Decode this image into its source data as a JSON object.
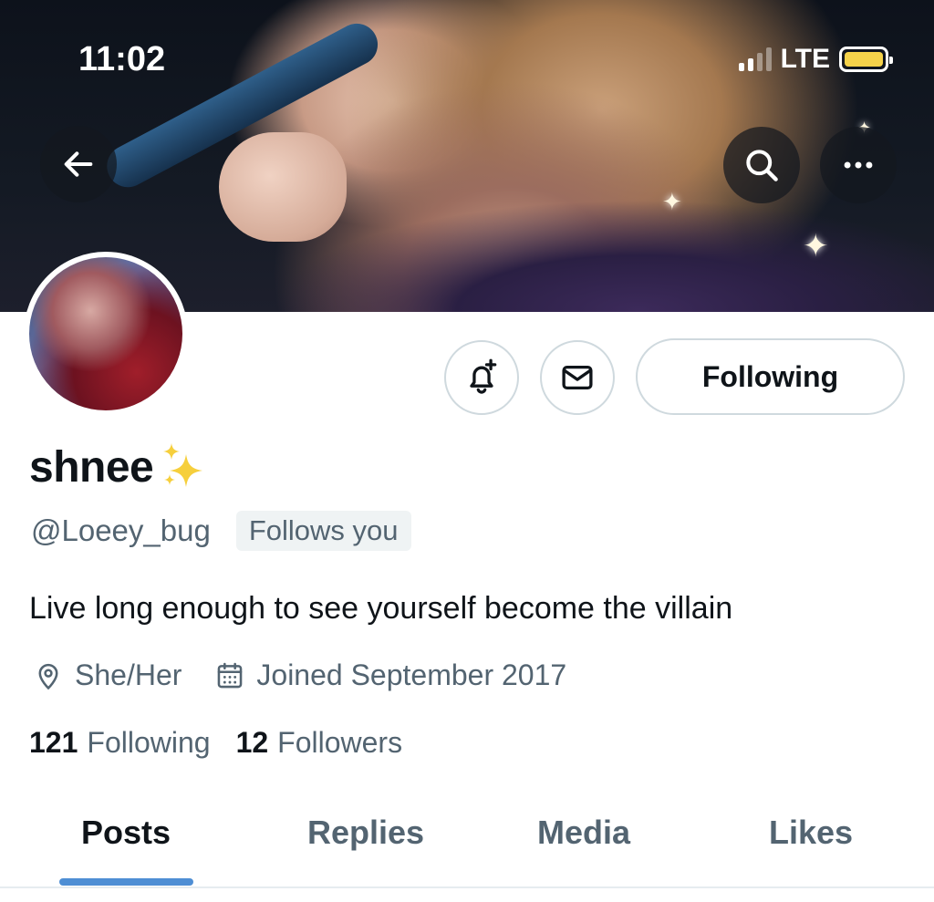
{
  "status_bar": {
    "time": "11:02",
    "network": "LTE",
    "battery_color": "#f5d24a",
    "signal_bars_active": 2,
    "signal_bars_total": 4
  },
  "header": {
    "back_icon": "arrow-left-icon",
    "search_icon": "search-icon",
    "more_icon": "more-horizontal-icon"
  },
  "actions": {
    "notify_icon": "bell-plus-icon",
    "message_icon": "envelope-icon",
    "following_label": "Following"
  },
  "profile": {
    "display_name": "shnee",
    "name_emoji_icon": "sparkles-icon",
    "handle": "@Loeey_bug",
    "follows_you": "Follows you",
    "bio": "Live long enough to see yourself become the villain",
    "location": "She/Her",
    "joined": "Joined September 2017",
    "following_count": "121",
    "following_label": "Following",
    "followers_count": "12",
    "followers_label": "Followers"
  },
  "tabs": [
    {
      "label": "Posts",
      "active": true
    },
    {
      "label": "Replies",
      "active": false
    },
    {
      "label": "Media",
      "active": false
    },
    {
      "label": "Likes",
      "active": false
    }
  ],
  "colors": {
    "accent_indicator": "#4e8ed4",
    "secondary_text": "#536471",
    "primary_text": "#0f1419"
  }
}
